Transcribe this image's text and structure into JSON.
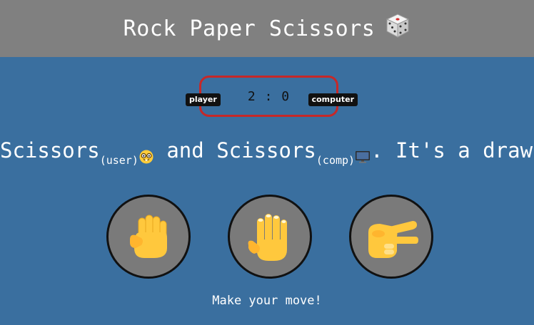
{
  "header": {
    "title": "Rock Paper Scissors",
    "icon": "dice-icon"
  },
  "scoreboard": {
    "player_label": "player",
    "computer_label": "computer",
    "score": "2 : 0"
  },
  "result": {
    "user_choice": "Scissors",
    "user_tag": "(user)",
    "connector": "and",
    "comp_choice": "Scissors",
    "comp_tag": "(comp)",
    "outcome": ". It's a draw."
  },
  "choices": [
    {
      "name": "rock",
      "icon": "fist-icon"
    },
    {
      "name": "paper",
      "icon": "open-hand-icon"
    },
    {
      "name": "scissors",
      "icon": "scissors-hand-icon"
    }
  ],
  "prompt": "Make your move!",
  "colors": {
    "header_bg": "#808080",
    "page_bg": "#3a6f9f",
    "score_border": "#c62828",
    "choice_bg": "#7a7a7a",
    "skin": "#ffc83d"
  }
}
